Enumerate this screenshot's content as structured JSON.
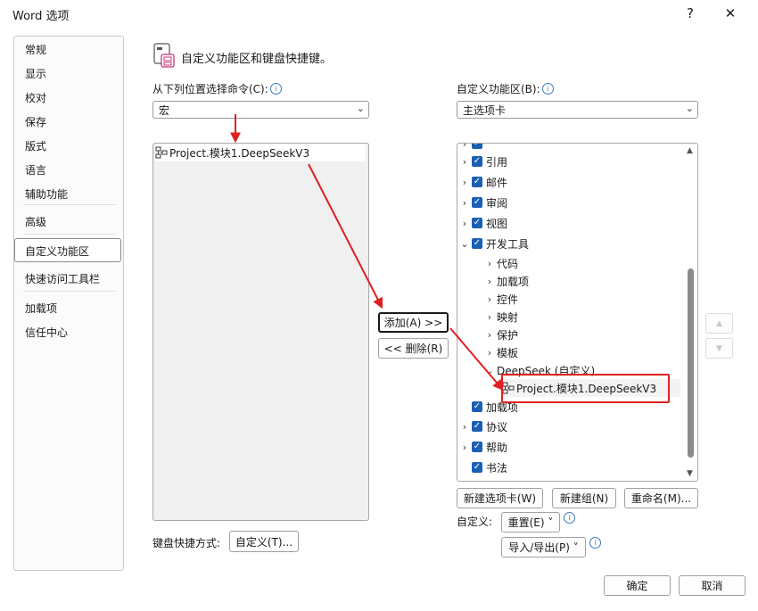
{
  "window": {
    "title": "Word 选项",
    "help_glyph": "?",
    "close_glyph": "✕"
  },
  "nav": {
    "items": [
      "常规",
      "显示",
      "校对",
      "保存",
      "版式",
      "语言",
      "辅助功能",
      "高级",
      "自定义功能区",
      "快速访问工具栏",
      "加载项",
      "信任中心"
    ],
    "selected_index": 8
  },
  "heading": "自定义功能区和键盘快捷键。",
  "left": {
    "label": "从下列位置选择命令(C):",
    "combo_value": "宏",
    "list_items": [
      "Project.模块1.DeepSeekV3"
    ]
  },
  "right": {
    "label": "自定义功能区(B):",
    "combo_value": "主选项卡",
    "tree": [
      {
        "label": "引用",
        "expand": ">",
        "checked": true,
        "level": 0
      },
      {
        "label": "邮件",
        "expand": ">",
        "checked": true,
        "level": 0
      },
      {
        "label": "审阅",
        "expand": ">",
        "checked": true,
        "level": 0
      },
      {
        "label": "视图",
        "expand": ">",
        "checked": true,
        "level": 0
      },
      {
        "label": "开发工具",
        "expand": "v",
        "checked": true,
        "level": 0
      },
      {
        "label": "代码",
        "expand": ">",
        "checked": false,
        "level": 1
      },
      {
        "label": "加载项",
        "expand": ">",
        "checked": false,
        "level": 1
      },
      {
        "label": "控件",
        "expand": ">",
        "checked": false,
        "level": 1
      },
      {
        "label": "映射",
        "expand": ">",
        "checked": false,
        "level": 1
      },
      {
        "label": "保护",
        "expand": ">",
        "checked": false,
        "level": 1
      },
      {
        "label": "模板",
        "expand": ">",
        "checked": false,
        "level": 1
      },
      {
        "label": "DeepSeek (自定义)",
        "expand": "v",
        "checked": false,
        "level": 1
      },
      {
        "label": "Project.模块1.DeepSeekV3",
        "expand": "",
        "checked": false,
        "level": 2
      },
      {
        "label": "加载项",
        "expand": "",
        "checked": true,
        "level": 0
      },
      {
        "label": "协议",
        "expand": ">",
        "checked": true,
        "level": 0
      },
      {
        "label": "帮助",
        "expand": ">",
        "checked": true,
        "level": 0
      },
      {
        "label": "书法",
        "expand": "",
        "checked": true,
        "level": 0
      }
    ]
  },
  "buttons": {
    "add": "添加(A) >>",
    "remove": "<< 删除(R)",
    "new_tab": "新建选项卡(W)",
    "new_group": "新建组(N)",
    "rename": "重命名(M)...",
    "customize_label": "自定义:",
    "reset": "重置(E) ˅",
    "import_export": "导入/导出(P) ˅",
    "keyboard_label": "键盘快捷方式:",
    "keyboard_customize": "自定义(T)...",
    "ok": "确定",
    "cancel": "取消"
  },
  "colors": {
    "accent": "#1a5fb4",
    "annotation_red": "#e02020"
  }
}
